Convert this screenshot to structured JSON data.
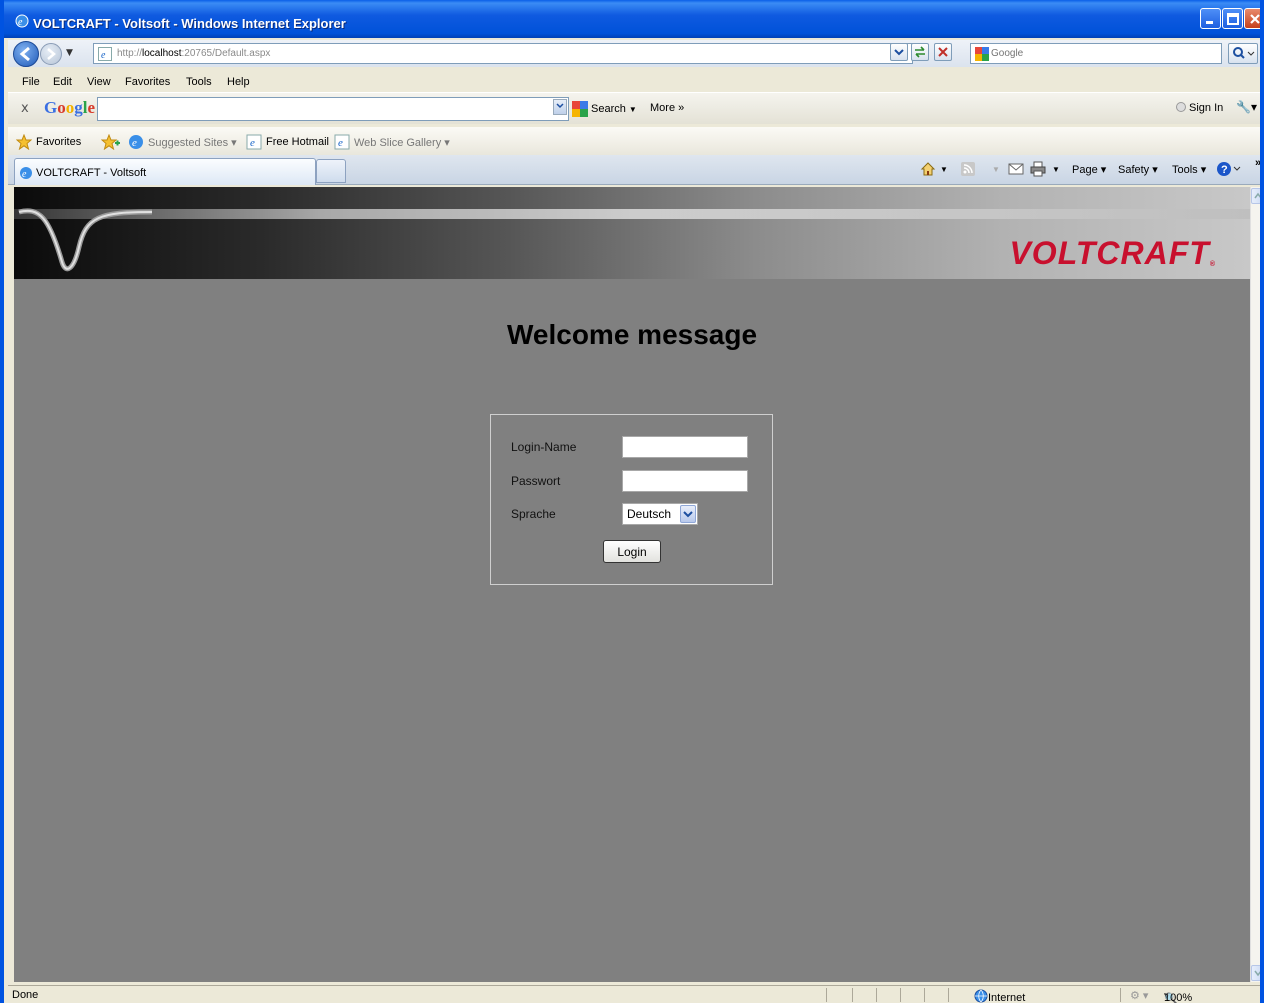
{
  "window": {
    "title": "VOLTCRAFT - Voltsoft - Windows Internet Explorer"
  },
  "address_bar": {
    "url_prefix": "http://",
    "url_host": "localhost",
    "url_rest": ":20765/Default.aspx",
    "search_placeholder": "Google"
  },
  "menu": {
    "items": [
      "File",
      "Edit",
      "View",
      "Favorites",
      "Tools",
      "Help"
    ]
  },
  "google_toolbar": {
    "close_label": "x",
    "logo": "Google",
    "search_label": "Search",
    "more_label": "More »",
    "sign_in_label": "Sign In"
  },
  "favorites_bar": {
    "favorites_label": "Favorites",
    "suggested_sites_label": "Suggested Sites ▾",
    "free_hotmail_label": "Free Hotmail",
    "web_slice_label": "Web Slice Gallery ▾"
  },
  "tabs": {
    "active_label": "VOLTCRAFT - Voltsoft"
  },
  "command_bar": {
    "page_label": "Page ▾",
    "safety_label": "Safety ▾",
    "tools_label": "Tools ▾",
    "overflow_label": "»"
  },
  "page": {
    "brand": "VOLTCRAFT",
    "brand_mark": "®",
    "welcome": "Welcome message",
    "login_name_label": "Login-Name",
    "login_name_value": "",
    "password_label": "Passwort",
    "password_value": "",
    "language_label": "Sprache",
    "language_value": "Deutsch",
    "login_button": "Login"
  },
  "status_bar": {
    "status": "Done",
    "zone": "Internet",
    "zoom": "100%"
  },
  "colors": {
    "brand_red": "#c8102e",
    "page_background": "#808080",
    "titlebar_blue": "#0052d9"
  }
}
